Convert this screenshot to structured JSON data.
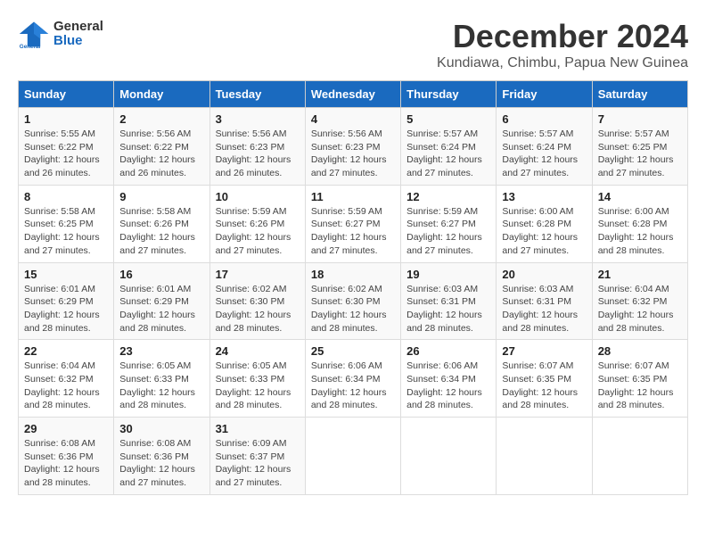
{
  "logo": {
    "line1": "General",
    "line2": "Blue"
  },
  "title": "December 2024",
  "subtitle": "Kundiawa, Chimbu, Papua New Guinea",
  "weekdays": [
    "Sunday",
    "Monday",
    "Tuesday",
    "Wednesday",
    "Thursday",
    "Friday",
    "Saturday"
  ],
  "weeks": [
    [
      {
        "day": "1",
        "info": "Sunrise: 5:55 AM\nSunset: 6:22 PM\nDaylight: 12 hours\nand 26 minutes."
      },
      {
        "day": "2",
        "info": "Sunrise: 5:56 AM\nSunset: 6:22 PM\nDaylight: 12 hours\nand 26 minutes."
      },
      {
        "day": "3",
        "info": "Sunrise: 5:56 AM\nSunset: 6:23 PM\nDaylight: 12 hours\nand 26 minutes."
      },
      {
        "day": "4",
        "info": "Sunrise: 5:56 AM\nSunset: 6:23 PM\nDaylight: 12 hours\nand 27 minutes."
      },
      {
        "day": "5",
        "info": "Sunrise: 5:57 AM\nSunset: 6:24 PM\nDaylight: 12 hours\nand 27 minutes."
      },
      {
        "day": "6",
        "info": "Sunrise: 5:57 AM\nSunset: 6:24 PM\nDaylight: 12 hours\nand 27 minutes."
      },
      {
        "day": "7",
        "info": "Sunrise: 5:57 AM\nSunset: 6:25 PM\nDaylight: 12 hours\nand 27 minutes."
      }
    ],
    [
      {
        "day": "8",
        "info": "Sunrise: 5:58 AM\nSunset: 6:25 PM\nDaylight: 12 hours\nand 27 minutes."
      },
      {
        "day": "9",
        "info": "Sunrise: 5:58 AM\nSunset: 6:26 PM\nDaylight: 12 hours\nand 27 minutes."
      },
      {
        "day": "10",
        "info": "Sunrise: 5:59 AM\nSunset: 6:26 PM\nDaylight: 12 hours\nand 27 minutes."
      },
      {
        "day": "11",
        "info": "Sunrise: 5:59 AM\nSunset: 6:27 PM\nDaylight: 12 hours\nand 27 minutes."
      },
      {
        "day": "12",
        "info": "Sunrise: 5:59 AM\nSunset: 6:27 PM\nDaylight: 12 hours\nand 27 minutes."
      },
      {
        "day": "13",
        "info": "Sunrise: 6:00 AM\nSunset: 6:28 PM\nDaylight: 12 hours\nand 27 minutes."
      },
      {
        "day": "14",
        "info": "Sunrise: 6:00 AM\nSunset: 6:28 PM\nDaylight: 12 hours\nand 28 minutes."
      }
    ],
    [
      {
        "day": "15",
        "info": "Sunrise: 6:01 AM\nSunset: 6:29 PM\nDaylight: 12 hours\nand 28 minutes."
      },
      {
        "day": "16",
        "info": "Sunrise: 6:01 AM\nSunset: 6:29 PM\nDaylight: 12 hours\nand 28 minutes."
      },
      {
        "day": "17",
        "info": "Sunrise: 6:02 AM\nSunset: 6:30 PM\nDaylight: 12 hours\nand 28 minutes."
      },
      {
        "day": "18",
        "info": "Sunrise: 6:02 AM\nSunset: 6:30 PM\nDaylight: 12 hours\nand 28 minutes."
      },
      {
        "day": "19",
        "info": "Sunrise: 6:03 AM\nSunset: 6:31 PM\nDaylight: 12 hours\nand 28 minutes."
      },
      {
        "day": "20",
        "info": "Sunrise: 6:03 AM\nSunset: 6:31 PM\nDaylight: 12 hours\nand 28 minutes."
      },
      {
        "day": "21",
        "info": "Sunrise: 6:04 AM\nSunset: 6:32 PM\nDaylight: 12 hours\nand 28 minutes."
      }
    ],
    [
      {
        "day": "22",
        "info": "Sunrise: 6:04 AM\nSunset: 6:32 PM\nDaylight: 12 hours\nand 28 minutes."
      },
      {
        "day": "23",
        "info": "Sunrise: 6:05 AM\nSunset: 6:33 PM\nDaylight: 12 hours\nand 28 minutes."
      },
      {
        "day": "24",
        "info": "Sunrise: 6:05 AM\nSunset: 6:33 PM\nDaylight: 12 hours\nand 28 minutes."
      },
      {
        "day": "25",
        "info": "Sunrise: 6:06 AM\nSunset: 6:34 PM\nDaylight: 12 hours\nand 28 minutes."
      },
      {
        "day": "26",
        "info": "Sunrise: 6:06 AM\nSunset: 6:34 PM\nDaylight: 12 hours\nand 28 minutes."
      },
      {
        "day": "27",
        "info": "Sunrise: 6:07 AM\nSunset: 6:35 PM\nDaylight: 12 hours\nand 28 minutes."
      },
      {
        "day": "28",
        "info": "Sunrise: 6:07 AM\nSunset: 6:35 PM\nDaylight: 12 hours\nand 28 minutes."
      }
    ],
    [
      {
        "day": "29",
        "info": "Sunrise: 6:08 AM\nSunset: 6:36 PM\nDaylight: 12 hours\nand 28 minutes."
      },
      {
        "day": "30",
        "info": "Sunrise: 6:08 AM\nSunset: 6:36 PM\nDaylight: 12 hours\nand 27 minutes."
      },
      {
        "day": "31",
        "info": "Sunrise: 6:09 AM\nSunset: 6:37 PM\nDaylight: 12 hours\nand 27 minutes."
      },
      null,
      null,
      null,
      null
    ]
  ]
}
